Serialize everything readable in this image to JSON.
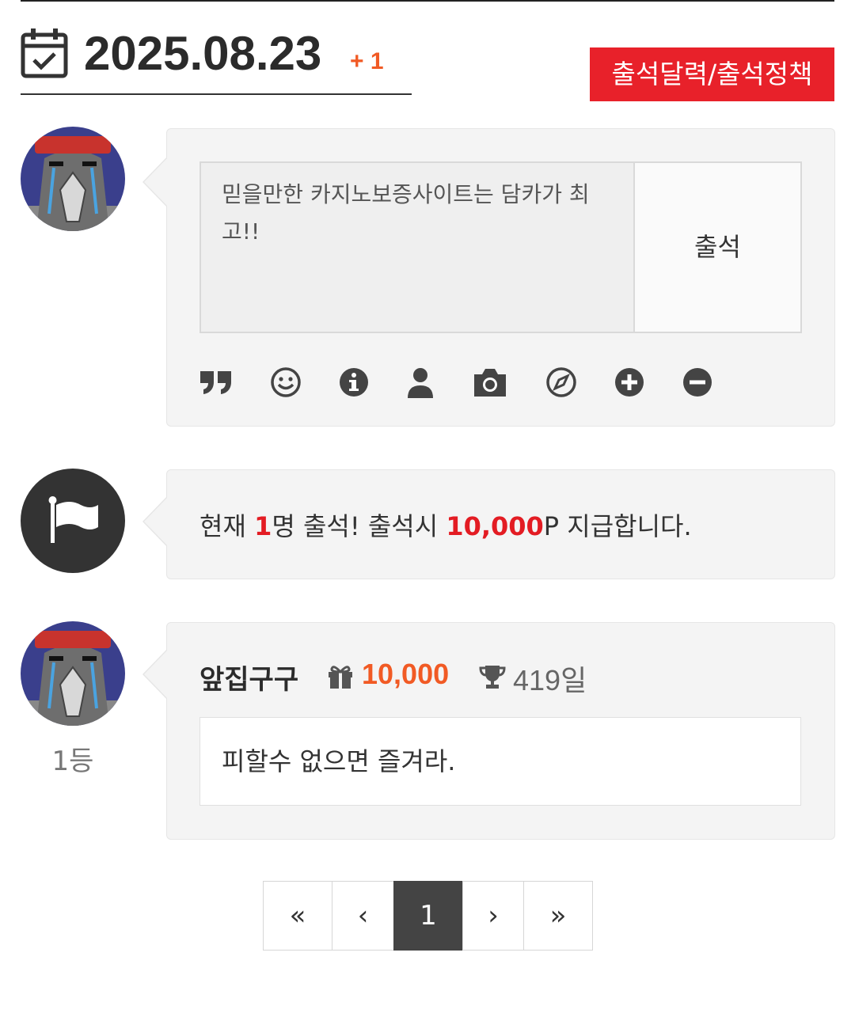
{
  "header": {
    "date": "2025.08.23",
    "plus": "+ 1",
    "policy_button": "출석달력/출석정책"
  },
  "composer": {
    "text": "믿을만한 카지노보증사이트는 담카가 최고!!",
    "submit_label": "출석",
    "tools": [
      "quote-icon",
      "smile-icon",
      "info-icon",
      "user-icon",
      "camera-icon",
      "compass-icon",
      "plus-circle-icon",
      "minus-circle-icon"
    ]
  },
  "notice": {
    "prefix": "현재 ",
    "count": "1",
    "middle": "명 출석! 출석시 ",
    "points": "10,000",
    "suffix": "P 지급합니다."
  },
  "entries": [
    {
      "username": "앞집구구",
      "points": "10,000",
      "days": "419일",
      "comment": "피할수 없으면 즐겨라.",
      "rank": "1등"
    }
  ],
  "pagination": {
    "first": "«",
    "prev": "‹",
    "current": "1",
    "next": "›",
    "last": "»"
  },
  "colors": {
    "accent_red": "#e8212a",
    "points_orange": "#f15a24",
    "dark": "#333333"
  }
}
